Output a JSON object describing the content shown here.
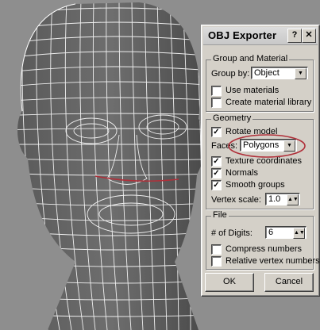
{
  "dialog": {
    "title": "OBJ Exporter",
    "help_button": "?",
    "close_button": "✕"
  },
  "group_material": {
    "legend": "Group and Material",
    "group_by_label": "Group by:",
    "group_by_value": "Object",
    "use_materials": "Use materials",
    "create_material_library": "Create material library"
  },
  "geometry": {
    "legend": "Geometry",
    "rotate_model": "Rotate model",
    "faces_label": "Faces:",
    "faces_value": "Polygons",
    "texture_coordinates": "Texture coordinates",
    "normals": "Normals",
    "smooth_groups": "Smooth groups",
    "vertex_scale_label": "Vertex scale:",
    "vertex_scale_value": "1.0"
  },
  "file": {
    "legend": "File",
    "digits_label": "# of Digits:",
    "digits_value": "6",
    "compress_numbers": "Compress numbers",
    "relative_vertex_numbers": "Relative vertex numbers"
  },
  "buttons": {
    "ok": "OK",
    "cancel": "Cancel"
  },
  "colors": {
    "background": "#8e8e8e",
    "wire": "#ffffff",
    "highlight": "#b0303a"
  }
}
